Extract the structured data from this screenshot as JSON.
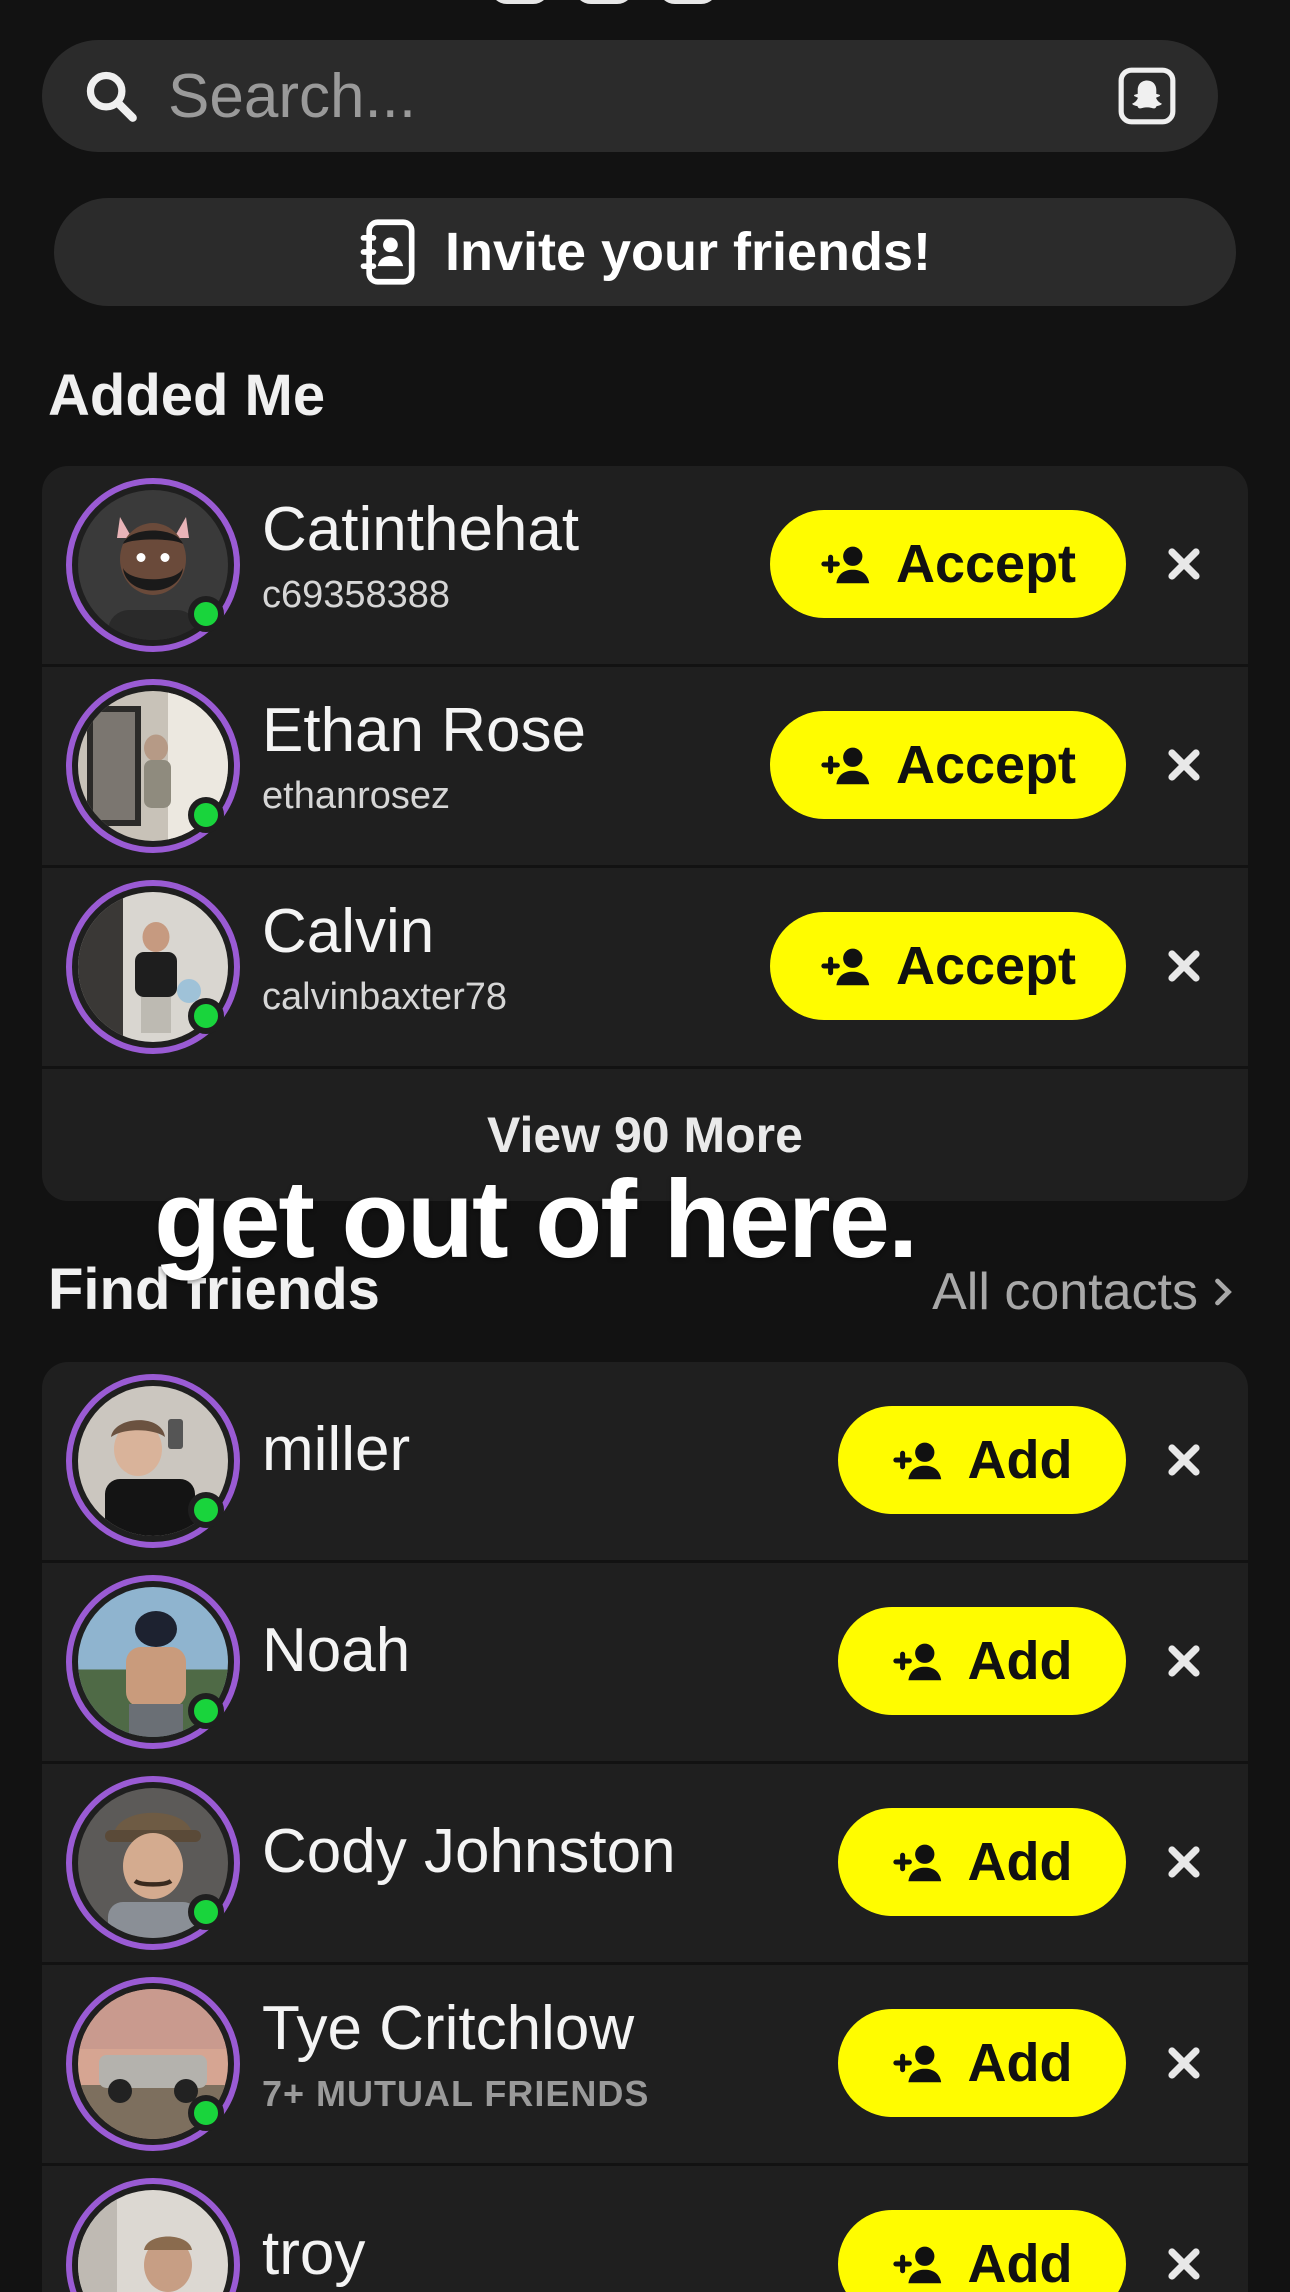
{
  "search": {
    "placeholder": "Search..."
  },
  "invite": {
    "label": "Invite your friends!"
  },
  "added_me": {
    "title": "Added Me",
    "rows": [
      {
        "name": "Catinthehat",
        "username": "c69358388",
        "action": "Accept",
        "online": true
      },
      {
        "name": "Ethan Rose",
        "username": "ethanrosez",
        "action": "Accept",
        "online": true
      },
      {
        "name": "Calvin",
        "username": "calvinbaxter78",
        "action": "Accept",
        "online": true
      }
    ],
    "view_more": "View 90 More"
  },
  "overlay_caption": "get out of here.",
  "find_friends": {
    "title": "Find friends",
    "all_contacts": "All contacts",
    "rows": [
      {
        "name": "miller",
        "action": "Add",
        "online": true
      },
      {
        "name": "Noah",
        "action": "Add",
        "online": true
      },
      {
        "name": "Cody Johnston",
        "action": "Add",
        "online": true
      },
      {
        "name": "Tye Critchlow",
        "subtitle": "7+ MUTUAL FRIENDS",
        "action": "Add",
        "online": true
      },
      {
        "name": "troy",
        "action": "Add",
        "online": false
      }
    ]
  },
  "colors": {
    "accent_yellow": "#fffc00",
    "avatar_ring": "#9a5bd4",
    "online_dot": "#19d43c",
    "background": "#121212",
    "card": "#1f1f1f"
  },
  "icons": [
    "search-icon",
    "snapchat-ghost-icon",
    "contact-book-icon",
    "add-friend-icon",
    "close-icon",
    "chevron-right-icon"
  ]
}
